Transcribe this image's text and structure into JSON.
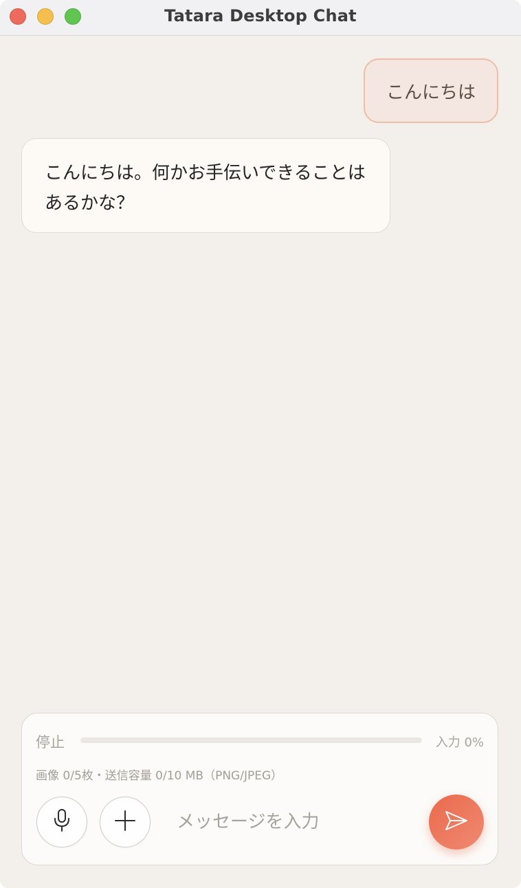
{
  "window": {
    "title": "Tatara Desktop Chat"
  },
  "messages": [
    {
      "role": "user",
      "text": "こんにちは"
    },
    {
      "role": "assistant",
      "text": "こんにちは。何かお手伝いできることはあるかな？"
    }
  ],
  "composer": {
    "stop_label": "停止",
    "input_label": "入力 0%",
    "input_progress": 0,
    "attachment_info": "画像 0/5枚・送信容量 0/10 MB（PNG/JPEG）",
    "placeholder": "メッセージを入力",
    "value": ""
  },
  "icons": {
    "mic": "microphone-icon",
    "add": "plus-icon",
    "send": "send-icon"
  },
  "colors": {
    "accent": "#ea6a4c",
    "user_bubble": "#f4e7e1",
    "user_bubble_border": "#efbda6",
    "assistant_bubble": "#fdfaf6",
    "background": "#f3f0eb"
  }
}
